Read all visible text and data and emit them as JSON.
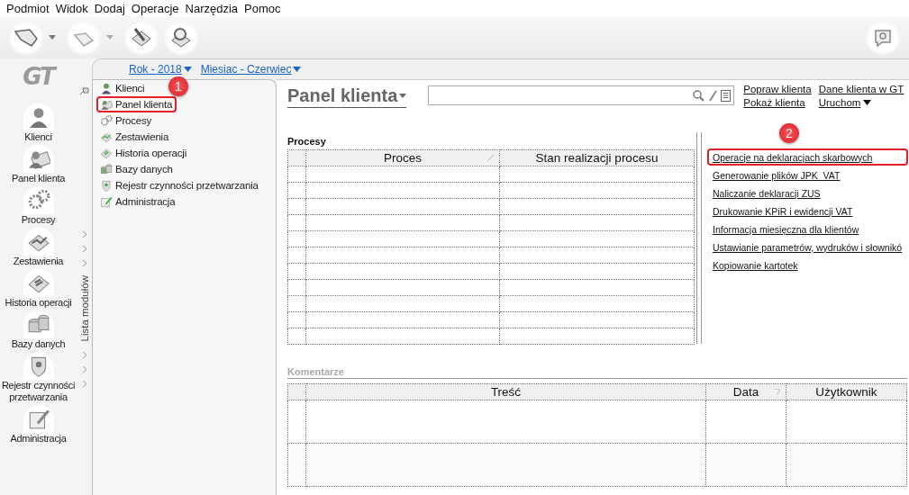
{
  "menu_bar": [
    "Podmiot",
    "Widok",
    "Dodaj",
    "Operacje",
    "Narzędzia",
    "Pomoc"
  ],
  "logo": "GT",
  "sidebar": {
    "items": [
      {
        "label": "Klienci"
      },
      {
        "label": "Panel klienta"
      },
      {
        "label": "Procesy"
      },
      {
        "label": "Zestawienia"
      },
      {
        "label": "Historia operacji"
      },
      {
        "label": "Bazy danych"
      },
      {
        "label": "Rejestr czynności przetwarzania"
      },
      {
        "label": "Administracja"
      }
    ]
  },
  "filters": [
    {
      "label": "Rok - 2018"
    },
    {
      "label": "Miesiac - Czerwiec"
    }
  ],
  "module_strip": {
    "label": "Lista modułów"
  },
  "module_list": [
    {
      "label": "Klienci",
      "highlighted": false
    },
    {
      "label": "Panel klienta",
      "highlighted": true,
      "badge": "1"
    },
    {
      "label": "Procesy",
      "highlighted": false
    },
    {
      "label": "Zestawienia",
      "highlighted": false
    },
    {
      "label": "Historia operacji",
      "highlighted": false
    },
    {
      "label": "Bazy danych",
      "highlighted": false
    },
    {
      "label": "Rejestr czynności przetwarzania",
      "highlighted": false
    },
    {
      "label": "Administracja",
      "highlighted": false
    }
  ],
  "panel": {
    "title": "Panel klienta",
    "actions": [
      "Popraw klienta",
      "Dane klienta w GT",
      "Pokaż klienta",
      "Uruchom"
    ],
    "processes": {
      "title": "Procesy",
      "columns": [
        "",
        "Proces",
        "Stan realizacji procesu"
      ]
    },
    "badge": "2",
    "links": [
      {
        "label": "Operacje na deklaracjach skarbowych",
        "highlighted": true
      },
      {
        "label": "Generowanie plików JPK_VAT",
        "highlighted": false
      },
      {
        "label": "Naliczanie deklaracji ZUS",
        "highlighted": false
      },
      {
        "label": "Drukowanie KPiR i ewidencji VAT",
        "highlighted": false
      },
      {
        "label": "Informacja miesięczna dla klientów",
        "highlighted": false
      },
      {
        "label": "Ustawianie parametrów, wydruków i słownikó",
        "highlighted": false
      },
      {
        "label": "Kopiowanie kartotek",
        "highlighted": false
      }
    ],
    "comments": {
      "title": "Komentarze",
      "columns": [
        "",
        "Treść",
        "Data",
        "Użytkownik"
      ]
    }
  }
}
